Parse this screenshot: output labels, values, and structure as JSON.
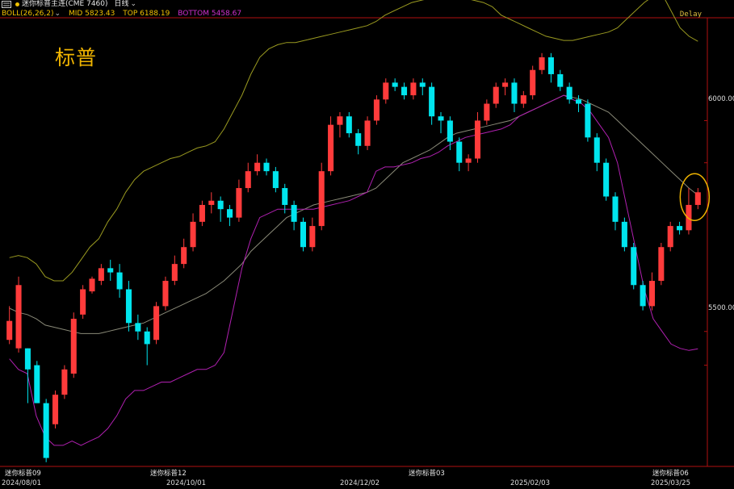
{
  "header": {
    "symbol": "迷你标普主连(CME 7460)",
    "period": "日线",
    "dot_color": "#f0c000"
  },
  "indicator": {
    "name": "BOLL(26,26,2)",
    "mid_label": "MID 5823.43",
    "top_label": "TOP 6188.19",
    "bottom_label": "BOTTOM 5458.67",
    "name_color": "#f0c000",
    "mid_color": "#f0c000",
    "top_color": "#f0c000",
    "bottom_color": "#d030d0"
  },
  "delay": "Delay",
  "watermark": "标普",
  "contracts": [
    "迷你标普09",
    "迷你标普12",
    "迷你标普03",
    "迷你标普06"
  ],
  "colors": {
    "up": "#ff3b3b",
    "down": "#00e5ee",
    "mid": "#8a8a78",
    "top": "#9a9a20",
    "bottom": "#b020b0",
    "highlight": "#f0b400",
    "axis": "#b01010"
  },
  "chart_data": {
    "type": "candlestick",
    "x_ticks": [
      "2024/08/01",
      "2024/10/01",
      "2024/12/02",
      "2025/02/03",
      "2025/03/25"
    ],
    "y_ticks": [
      "6000.00",
      "5500.00"
    ],
    "ylim": [
      5180,
      6240
    ],
    "annotation": "circle around latest candles",
    "series": [
      {
        "name": "MID",
        "values": [
          5555,
          5545,
          5540,
          5530,
          5515,
          5510,
          5505,
          5500,
          5495,
          5495,
          5495,
          5500,
          5505,
          5510,
          5515,
          5520,
          5530,
          5540,
          5550,
          5560,
          5570,
          5580,
          5590,
          5605,
          5620,
          5640,
          5660,
          5690,
          5710,
          5730,
          5750,
          5770,
          5780,
          5790,
          5800,
          5805,
          5810,
          5815,
          5820,
          5825,
          5830,
          5840,
          5860,
          5880,
          5900,
          5910,
          5920,
          5930,
          5945,
          5960,
          5970,
          5975,
          5980,
          5985,
          5990,
          5995,
          6000,
          6010,
          6020,
          6030,
          6040,
          6050,
          6060,
          6055,
          6050,
          6040,
          6030,
          6020,
          6000,
          5980,
          5960,
          5940,
          5920,
          5900,
          5880,
          5860,
          5840,
          5823
        ]
      },
      {
        "name": "TOP",
        "values": [
          5675,
          5680,
          5675,
          5660,
          5630,
          5620,
          5620,
          5640,
          5670,
          5700,
          5720,
          5760,
          5790,
          5830,
          5860,
          5880,
          5890,
          5900,
          5910,
          5915,
          5925,
          5935,
          5940,
          5950,
          5980,
          6020,
          6060,
          6110,
          6150,
          6170,
          6180,
          6185,
          6185,
          6190,
          6195,
          6200,
          6205,
          6210,
          6215,
          6220,
          6225,
          6235,
          6250,
          6260,
          6270,
          6280,
          6285,
          6290,
          6290,
          6295,
          6295,
          6290,
          6285,
          6280,
          6270,
          6250,
          6240,
          6230,
          6220,
          6210,
          6200,
          6195,
          6190,
          6190,
          6195,
          6200,
          6205,
          6210,
          6220,
          6240,
          6260,
          6280,
          6295,
          6300,
          6260,
          6220,
          6200,
          6188
        ]
      },
      {
        "name": "BOTTOM",
        "values": [
          5435,
          5410,
          5400,
          5300,
          5250,
          5230,
          5230,
          5240,
          5230,
          5240,
          5250,
          5270,
          5300,
          5340,
          5360,
          5360,
          5370,
          5380,
          5380,
          5390,
          5400,
          5410,
          5410,
          5420,
          5450,
          5550,
          5650,
          5720,
          5770,
          5780,
          5790,
          5790,
          5790,
          5790,
          5790,
          5795,
          5800,
          5805,
          5810,
          5820,
          5830,
          5880,
          5890,
          5890,
          5895,
          5900,
          5910,
          5915,
          5925,
          5940,
          5950,
          5960,
          5965,
          5970,
          5975,
          5980,
          5990,
          6010,
          6020,
          6030,
          6040,
          6050,
          6060,
          6050,
          6040,
          6020,
          5990,
          5960,
          5900,
          5800,
          5700,
          5600,
          5530,
          5500,
          5470,
          5460,
          5455,
          5459
        ]
      },
      {
        "name": "candles",
        "values": [
          [
            5480,
            5525,
            5470,
            5560,
            5450
          ],
          [
            5460,
            5610,
            5450,
            5630,
            5440
          ],
          [
            5460,
            5410,
            5330,
            5460,
            5320
          ],
          [
            5420,
            5330,
            5330,
            5430,
            5280
          ],
          [
            5330,
            5200,
            5190,
            5340,
            5180
          ],
          [
            5280,
            5350,
            5270,
            5360,
            5260
          ],
          [
            5350,
            5410,
            5340,
            5420,
            5330
          ],
          [
            5400,
            5530,
            5390,
            5545,
            5380
          ],
          [
            5540,
            5600,
            5530,
            5610,
            5520
          ],
          [
            5595,
            5625,
            5590,
            5630,
            5580
          ],
          [
            5620,
            5650,
            5610,
            5660,
            5600
          ],
          [
            5650,
            5640,
            5620,
            5670,
            5610
          ],
          [
            5640,
            5600,
            5580,
            5660,
            5570
          ],
          [
            5600,
            5520,
            5500,
            5620,
            5490
          ],
          [
            5520,
            5500,
            5480,
            5540,
            5470
          ],
          [
            5500,
            5470,
            5420,
            5510,
            5410
          ],
          [
            5480,
            5560,
            5470,
            5570,
            5460
          ],
          [
            5560,
            5620,
            5550,
            5630,
            5540
          ],
          [
            5620,
            5660,
            5610,
            5680,
            5600
          ],
          [
            5660,
            5700,
            5650,
            5720,
            5640
          ],
          [
            5700,
            5760,
            5690,
            5780,
            5680
          ],
          [
            5760,
            5800,
            5750,
            5810,
            5740
          ],
          [
            5800,
            5810,
            5780,
            5830,
            5770
          ],
          [
            5810,
            5790,
            5760,
            5820,
            5750
          ],
          [
            5790,
            5770,
            5750,
            5800,
            5740
          ],
          [
            5770,
            5840,
            5760,
            5860,
            5750
          ],
          [
            5840,
            5880,
            5830,
            5900,
            5820
          ],
          [
            5880,
            5900,
            5870,
            5920,
            5860
          ],
          [
            5900,
            5880,
            5870,
            5910,
            5860
          ],
          [
            5880,
            5840,
            5830,
            5890,
            5820
          ],
          [
            5840,
            5800,
            5780,
            5850,
            5770
          ],
          [
            5800,
            5760,
            5740,
            5810,
            5730
          ],
          [
            5760,
            5700,
            5690,
            5770,
            5680
          ],
          [
            5700,
            5750,
            5690,
            5770,
            5680
          ],
          [
            5750,
            5880,
            5740,
            5900,
            5730
          ],
          [
            5880,
            5990,
            5870,
            6010,
            5860
          ],
          [
            5990,
            6010,
            5960,
            6020,
            5950
          ],
          [
            6010,
            5970,
            5960,
            6020,
            5950
          ],
          [
            5970,
            5940,
            5920,
            5980,
            5910
          ],
          [
            5940,
            6000,
            5930,
            6010,
            5920
          ],
          [
            6000,
            6050,
            5990,
            6060,
            5980
          ],
          [
            6050,
            6090,
            6040,
            6100,
            6030
          ],
          [
            6090,
            6080,
            6070,
            6100,
            6060
          ],
          [
            6080,
            6060,
            6050,
            6090,
            6040
          ],
          [
            6060,
            6090,
            6050,
            6100,
            6040
          ],
          [
            6090,
            6080,
            6060,
            6100,
            6050
          ],
          [
            6080,
            6010,
            5990,
            6090,
            5980
          ],
          [
            6010,
            6000,
            5970,
            6020,
            5960
          ],
          [
            6000,
            5950,
            5930,
            6010,
            5920
          ],
          [
            5950,
            5900,
            5880,
            5960,
            5870
          ],
          [
            5900,
            5910,
            5880,
            5920,
            5860
          ],
          [
            5910,
            6000,
            5900,
            6020,
            5890
          ],
          [
            6000,
            6040,
            5990,
            6050,
            5980
          ],
          [
            6040,
            6080,
            6030,
            6090,
            6020
          ],
          [
            6080,
            6090,
            6060,
            6100,
            6050
          ],
          [
            6090,
            6040,
            6020,
            6100,
            6010
          ],
          [
            6040,
            6060,
            6030,
            6070,
            6020
          ],
          [
            6060,
            6120,
            6050,
            6130,
            6040
          ],
          [
            6120,
            6150,
            6110,
            6160,
            6100
          ],
          [
            6150,
            6110,
            6090,
            6160,
            6080
          ],
          [
            6110,
            6080,
            6070,
            6120,
            6060
          ],
          [
            6080,
            6050,
            6040,
            6090,
            6030
          ],
          [
            6050,
            6040,
            6020,
            6060,
            6010
          ],
          [
            6040,
            5960,
            5950,
            6050,
            5940
          ],
          [
            5960,
            5900,
            5880,
            5970,
            5870
          ],
          [
            5900,
            5820,
            5810,
            5910,
            5800
          ],
          [
            5820,
            5760,
            5740,
            5830,
            5730
          ],
          [
            5760,
            5700,
            5690,
            5770,
            5680
          ],
          [
            5700,
            5610,
            5600,
            5710,
            5590
          ],
          [
            5610,
            5560,
            5550,
            5620,
            5540
          ],
          [
            5560,
            5620,
            5550,
            5640,
            5540
          ],
          [
            5620,
            5700,
            5610,
            5710,
            5600
          ],
          [
            5700,
            5750,
            5690,
            5760,
            5680
          ],
          [
            5750,
            5740,
            5730,
            5760,
            5720
          ],
          [
            5740,
            5800,
            5730,
            5840,
            5720
          ],
          [
            5800,
            5830,
            5790,
            5840,
            5780
          ]
        ]
      }
    ],
    "candle_fields": [
      "open",
      "close",
      "low",
      "high",
      "pad"
    ]
  }
}
